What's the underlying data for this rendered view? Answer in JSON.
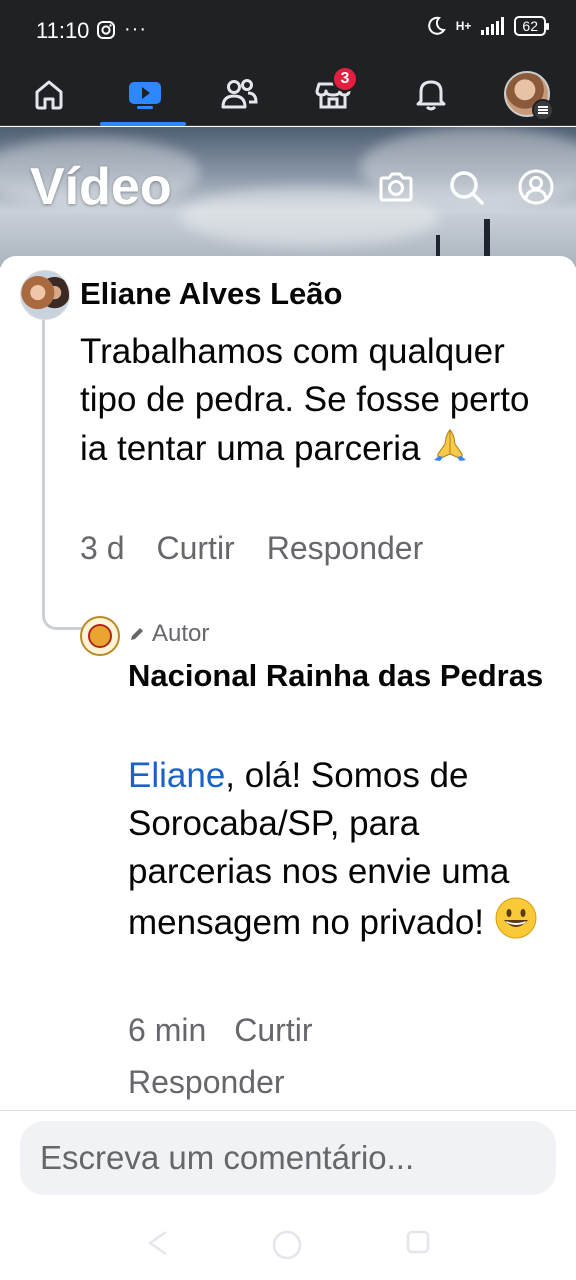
{
  "status_bar": {
    "time": "11:10",
    "left_icons": [
      "instagram-icon",
      "more-icon"
    ],
    "network": "H+",
    "battery": "62"
  },
  "nav": {
    "items": [
      {
        "name": "home-icon",
        "active": false
      },
      {
        "name": "video-icon",
        "active": true
      },
      {
        "name": "friends-icon",
        "active": false
      },
      {
        "name": "marketplace-icon",
        "active": false,
        "badge": "3"
      },
      {
        "name": "bell-icon",
        "active": false
      },
      {
        "name": "profile-avatar",
        "active": false
      }
    ],
    "accent": "#2d88ff"
  },
  "header": {
    "title": "Vídeo",
    "icons": [
      "camera-icon",
      "search-icon",
      "profile-icon"
    ]
  },
  "comments": [
    {
      "author": "Eliane Alves Leão",
      "text": "Trabalhamos com qualquer tipo de pedra. Se fosse perto ia tentar uma parceria",
      "emoji": "🙏",
      "time": "3 d",
      "like_label": "Curtir",
      "reply_label": "Responder"
    }
  ],
  "reply": {
    "badge": "Autor",
    "author": "Nacional Rainha das Pedras",
    "mention": "Eliane",
    "text": ", olá! Somos de Sorocaba/SP, para parcerias nos envie uma mensagem no privado!",
    "emoji": "😀",
    "time": "6 min",
    "like_label": "Curtir",
    "reply_label": "Responder"
  },
  "composer": {
    "placeholder": "Escreva um comentário..."
  },
  "colors": {
    "mention": "#1a62c6",
    "badge": "#e41e3f",
    "meta": "#65676b"
  }
}
